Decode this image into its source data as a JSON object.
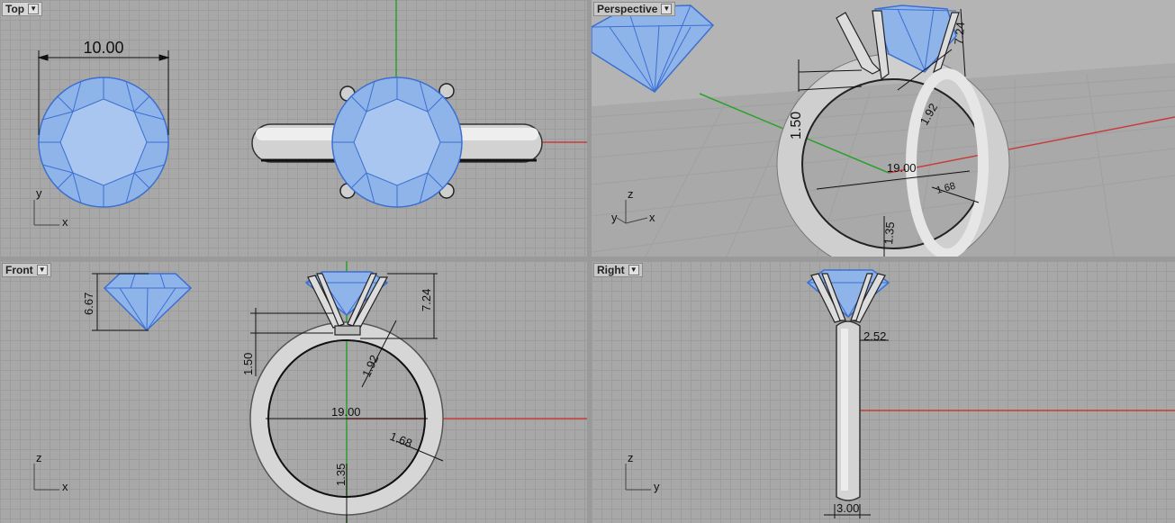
{
  "viewports": {
    "top": {
      "label": "Top",
      "dims": {
        "diameter": "10.00"
      },
      "axis": {
        "x": "x",
        "y": "y"
      }
    },
    "perspective": {
      "label": "Perspective",
      "dims": {
        "height": "7.24",
        "gap": "1.50",
        "prong": "1.92",
        "inner": "19.00",
        "band": "1.68",
        "bottom": "1.35"
      },
      "axis": {
        "x": "x",
        "y": "y",
        "z": "z"
      }
    },
    "front": {
      "label": "Front",
      "dims": {
        "stone": "6.67",
        "height": "7.24",
        "gap": "1.50",
        "prong": "1.92",
        "inner": "19.00",
        "band": "1.68",
        "bottom": "1.35"
      },
      "axis": {
        "x": "x",
        "z": "z"
      }
    },
    "right": {
      "label": "Right",
      "dims": {
        "shank": "2.52",
        "width": "3.00"
      },
      "axis": {
        "y": "y",
        "z": "z"
      }
    }
  },
  "colors": {
    "gem": "#8fb4ea",
    "gem_edge": "#3d6fd0",
    "metal": "#d8d8d8",
    "x_axis": "#c83c3c",
    "z_axis": "#2ea02e"
  },
  "icons": {
    "viewport_menu": "chevron-down-icon"
  }
}
